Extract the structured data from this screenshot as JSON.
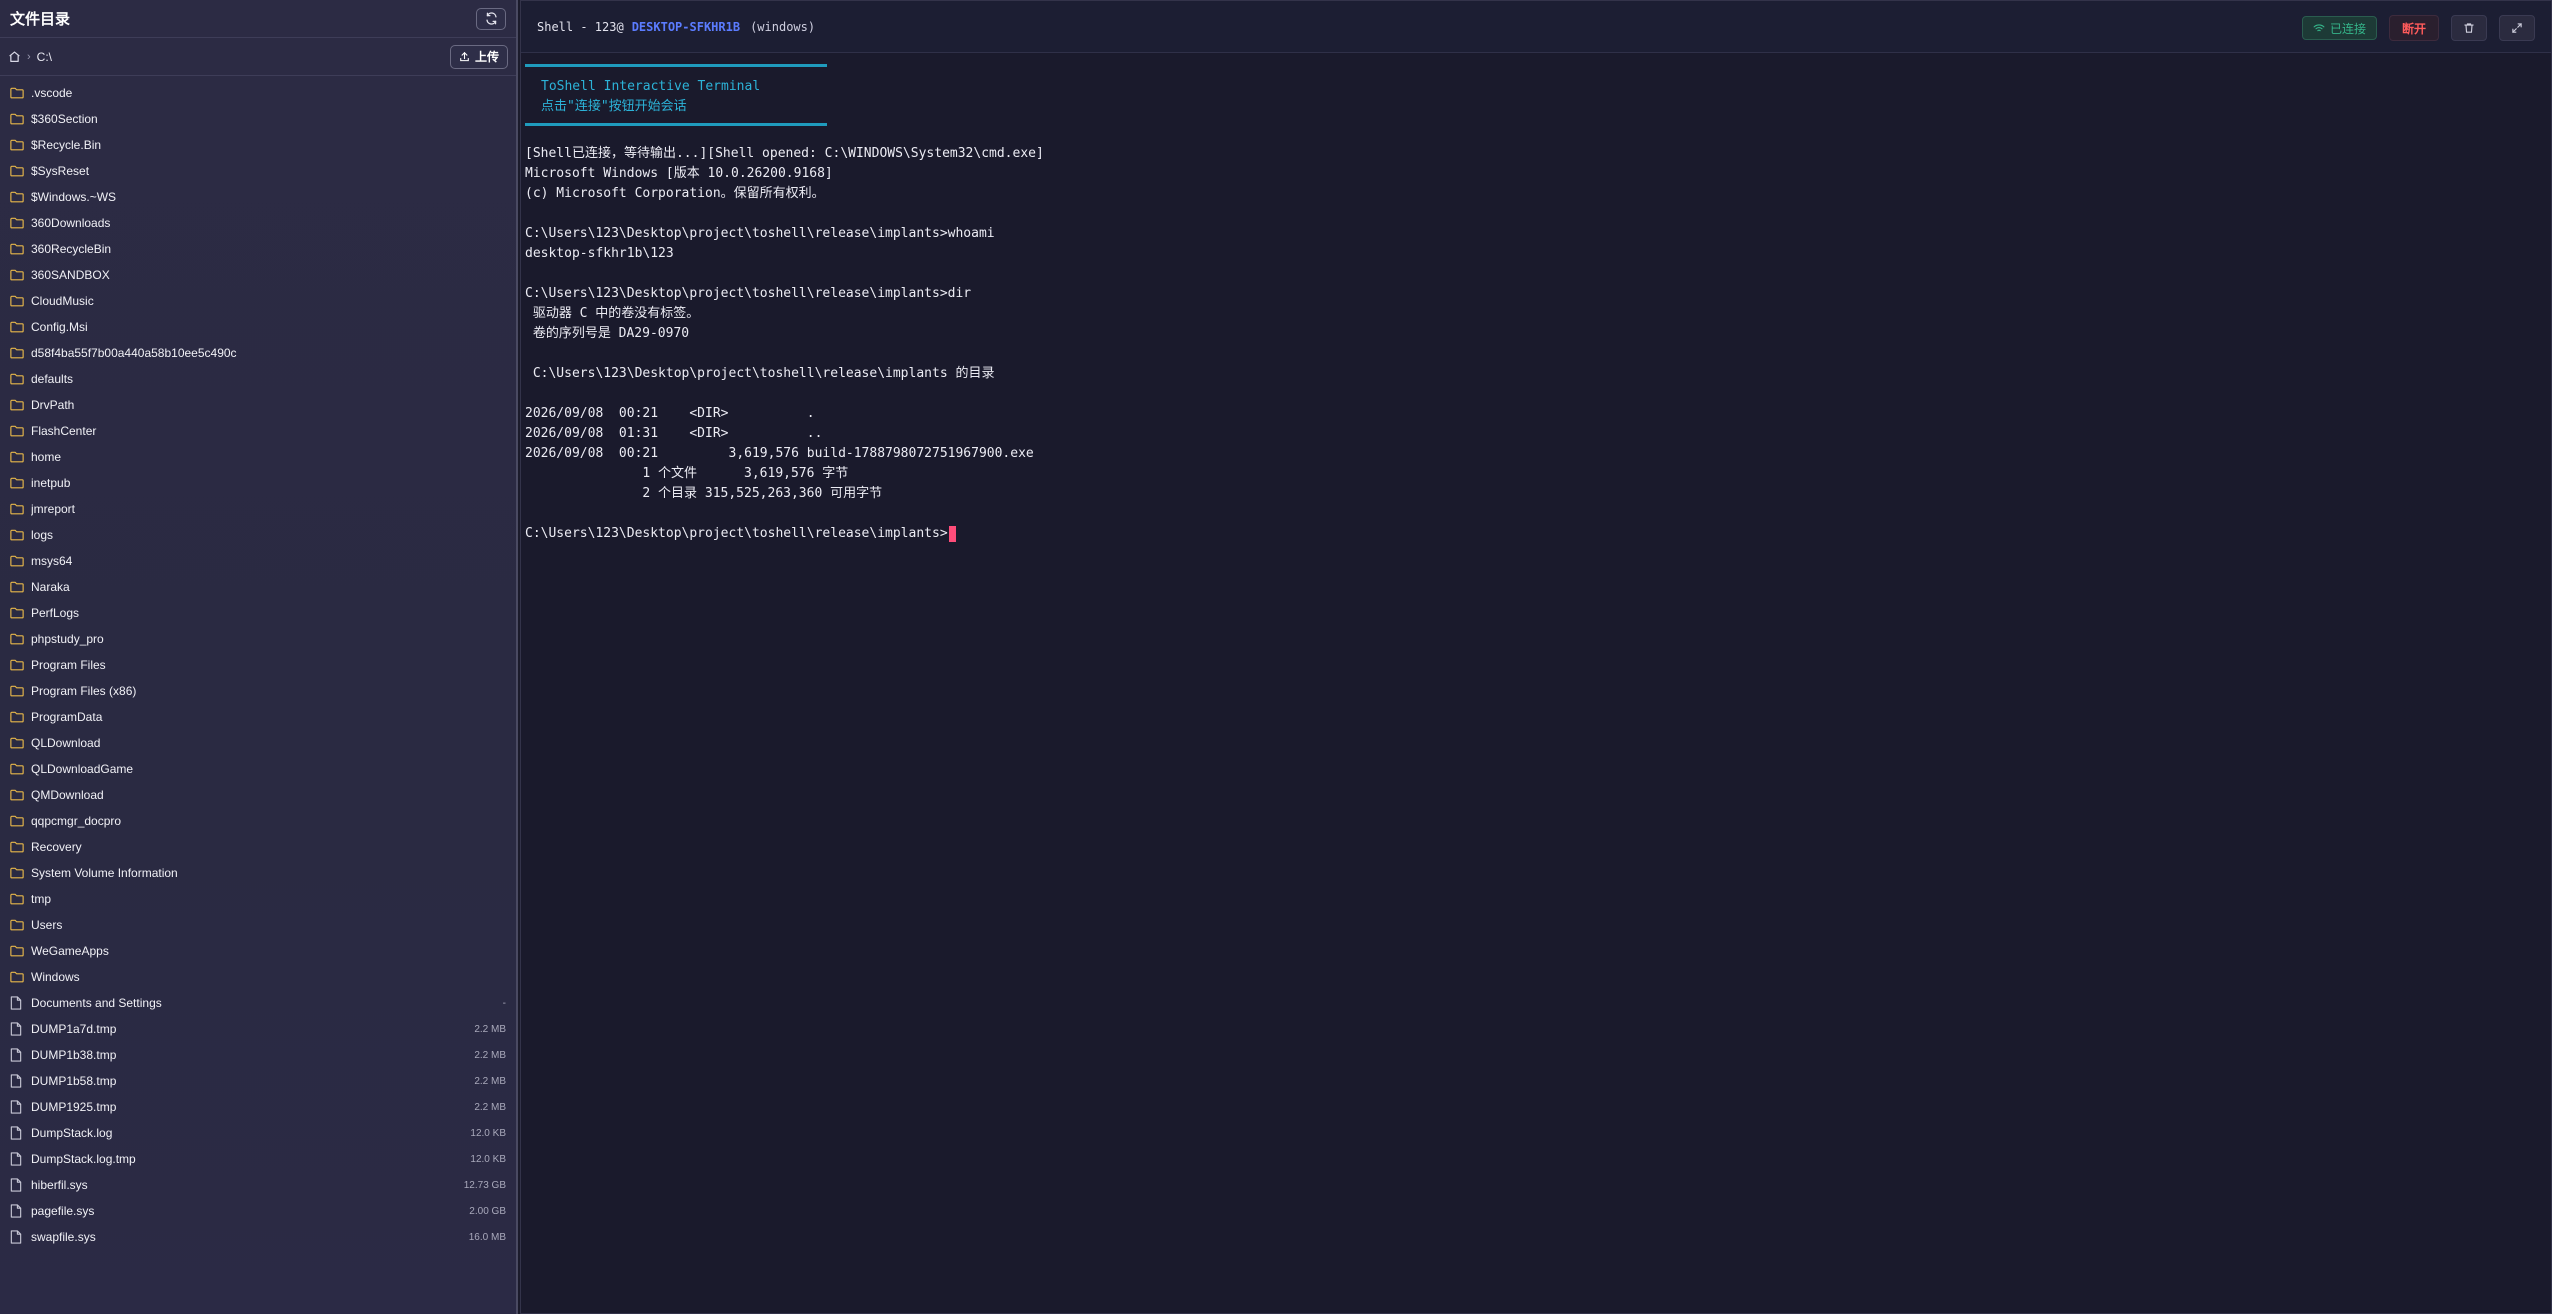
{
  "sidebar": {
    "title": "文件目录",
    "path": "C:\\",
    "upload_label": "上传",
    "items": [
      {
        "name": ".vscode",
        "type": "folder",
        "size": ""
      },
      {
        "name": "$360Section",
        "type": "folder",
        "size": ""
      },
      {
        "name": "$Recycle.Bin",
        "type": "folder",
        "size": ""
      },
      {
        "name": "$SysReset",
        "type": "folder",
        "size": ""
      },
      {
        "name": "$Windows.~WS",
        "type": "folder",
        "size": ""
      },
      {
        "name": "360Downloads",
        "type": "folder",
        "size": ""
      },
      {
        "name": "360RecycleBin",
        "type": "folder",
        "size": ""
      },
      {
        "name": "360SANDBOX",
        "type": "folder",
        "size": ""
      },
      {
        "name": "CloudMusic",
        "type": "folder",
        "size": ""
      },
      {
        "name": "Config.Msi",
        "type": "folder",
        "size": ""
      },
      {
        "name": "d58f4ba55f7b00a440a58b10ee5c490c",
        "type": "folder",
        "size": ""
      },
      {
        "name": "defaults",
        "type": "folder",
        "size": ""
      },
      {
        "name": "DrvPath",
        "type": "folder",
        "size": ""
      },
      {
        "name": "FlashCenter",
        "type": "folder",
        "size": ""
      },
      {
        "name": "home",
        "type": "folder",
        "size": ""
      },
      {
        "name": "inetpub",
        "type": "folder",
        "size": ""
      },
      {
        "name": "jmreport",
        "type": "folder",
        "size": ""
      },
      {
        "name": "logs",
        "type": "folder",
        "size": ""
      },
      {
        "name": "msys64",
        "type": "folder",
        "size": ""
      },
      {
        "name": "Naraka",
        "type": "folder",
        "size": ""
      },
      {
        "name": "PerfLogs",
        "type": "folder",
        "size": ""
      },
      {
        "name": "phpstudy_pro",
        "type": "folder",
        "size": ""
      },
      {
        "name": "Program Files",
        "type": "folder",
        "size": ""
      },
      {
        "name": "Program Files (x86)",
        "type": "folder",
        "size": ""
      },
      {
        "name": "ProgramData",
        "type": "folder",
        "size": ""
      },
      {
        "name": "QLDownload",
        "type": "folder",
        "size": ""
      },
      {
        "name": "QLDownloadGame",
        "type": "folder",
        "size": ""
      },
      {
        "name": "QMDownload",
        "type": "folder",
        "size": ""
      },
      {
        "name": "qqpcmgr_docpro",
        "type": "folder",
        "size": ""
      },
      {
        "name": "Recovery",
        "type": "folder",
        "size": ""
      },
      {
        "name": "System Volume Information",
        "type": "folder",
        "size": ""
      },
      {
        "name": "tmp",
        "type": "folder",
        "size": ""
      },
      {
        "name": "Users",
        "type": "folder",
        "size": ""
      },
      {
        "name": "WeGameApps",
        "type": "folder",
        "size": ""
      },
      {
        "name": "Windows",
        "type": "folder",
        "size": ""
      },
      {
        "name": "Documents and Settings",
        "type": "file",
        "size": "-"
      },
      {
        "name": "DUMP1a7d.tmp",
        "type": "file",
        "size": "2.2 MB"
      },
      {
        "name": "DUMP1b38.tmp",
        "type": "file",
        "size": "2.2 MB"
      },
      {
        "name": "DUMP1b58.tmp",
        "type": "file",
        "size": "2.2 MB"
      },
      {
        "name": "DUMP1925.tmp",
        "type": "file",
        "size": "2.2 MB"
      },
      {
        "name": "DumpStack.log",
        "type": "file",
        "size": "12.0 KB"
      },
      {
        "name": "DumpStack.log.tmp",
        "type": "file",
        "size": "12.0 KB"
      },
      {
        "name": "hiberfil.sys",
        "type": "file",
        "size": "12.73 GB"
      },
      {
        "name": "pagefile.sys",
        "type": "file",
        "size": "2.00 GB"
      },
      {
        "name": "swapfile.sys",
        "type": "file",
        "size": "16.0 MB"
      }
    ]
  },
  "terminal": {
    "header": {
      "prefix": "Shell - 123@",
      "hostname": "DESKTOP-SFKHR1B",
      "os": "(windows)"
    },
    "status_label": "已连接",
    "disconnect_label": "断开",
    "banner": {
      "title": "ToShell Interactive Terminal",
      "subtitle": "点击\"连接\"按钮开始会话"
    },
    "lines": [
      "[Shell已连接，等待输出...][Shell opened: C:\\WINDOWS\\System32\\cmd.exe]",
      "Microsoft Windows [版本 10.0.26200.9168]",
      "(c) Microsoft Corporation。保留所有权利。",
      "",
      "C:\\Users\\123\\Desktop\\project\\toshell\\release\\implants>whoami",
      "desktop-sfkhr1b\\123",
      "",
      "C:\\Users\\123\\Desktop\\project\\toshell\\release\\implants>dir",
      " 驱动器 C 中的卷没有标签。",
      " 卷的序列号是 DA29-0970",
      "",
      " C:\\Users\\123\\Desktop\\project\\toshell\\release\\implants 的目录",
      "",
      "2026/09/08  00:21    <DIR>          .",
      "2026/09/08  01:31    <DIR>          ..",
      "2026/09/08  00:21         3,619,576 build-1788798072751967900.exe",
      "               1 个文件      3,619,576 字节",
      "               2 个目录 315,525,263,360 可用字节",
      ""
    ],
    "prompt": "C:\\Users\\123\\Desktop\\project\\toshell\\release\\implants>"
  },
  "colors": {
    "accent_cyan": "#1f9bbd",
    "host_blue": "#5b7cff",
    "connected_green": "#35b58a",
    "danger_red": "#ff5b5b",
    "cursor_pink": "#ff4d7a",
    "folder_yellow": "#e8b84a"
  }
}
